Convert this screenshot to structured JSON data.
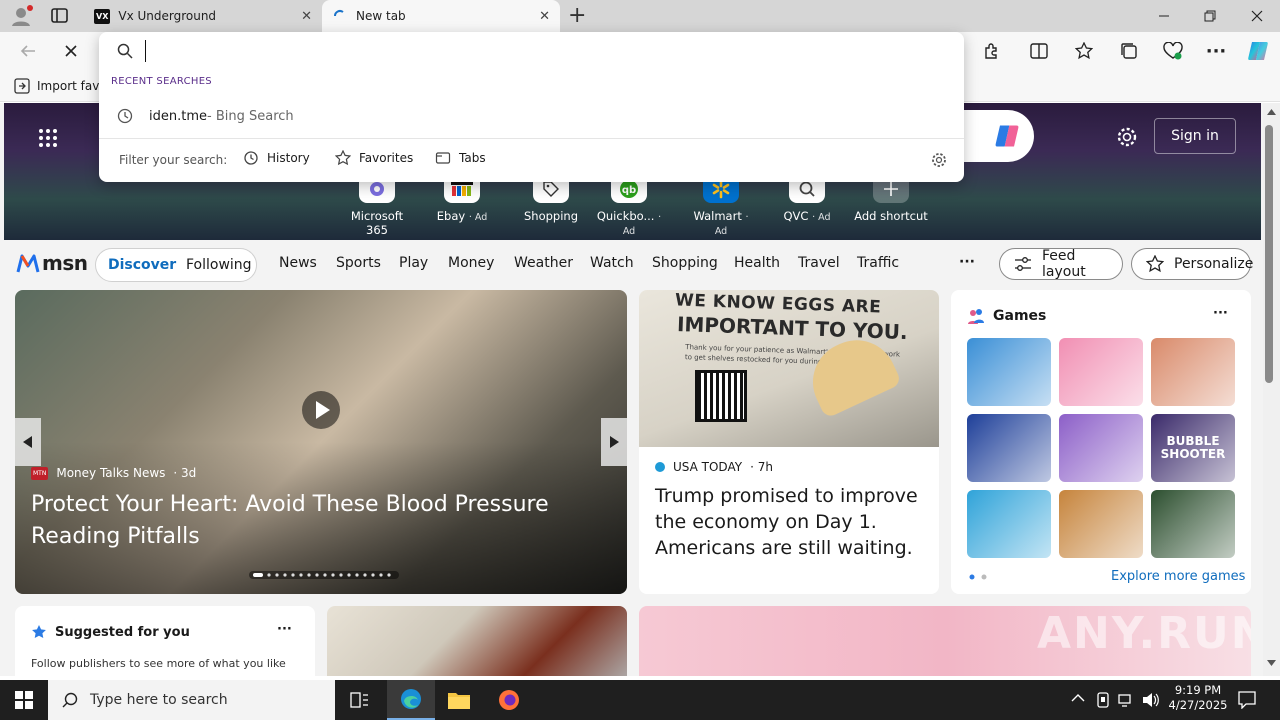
{
  "browser": {
    "tabs": [
      {
        "title": "Vx Underground",
        "favicon": "VX",
        "close": "✕"
      },
      {
        "title": "New tab",
        "close": "✕"
      }
    ],
    "new_tab": "+",
    "favbar_text": "Import favo"
  },
  "omnibox": {
    "value": "",
    "recent_header": "RECENT SEARCHES",
    "recent": [
      {
        "text": "iden.tme",
        "suffix": " - Bing Search"
      }
    ],
    "filter_label": "Filter your search:",
    "filters": [
      "History",
      "Favorites",
      "Tabs"
    ]
  },
  "hero": {
    "sign_in": "Sign in",
    "tiles": [
      {
        "label": "Microsoft 365",
        "ad": ""
      },
      {
        "label": "Ebay",
        "ad": "· Ad"
      },
      {
        "label": "Shopping",
        "ad": ""
      },
      {
        "label": "Quickbo...",
        "ad": "· Ad"
      },
      {
        "label": "Walmart",
        "ad": "· Ad"
      },
      {
        "label": "QVC",
        "ad": "· Ad"
      },
      {
        "label": "Add shortcut",
        "ad": ""
      }
    ]
  },
  "msn": {
    "brand": "msn",
    "discover": "Discover",
    "following": "Following",
    "nav": [
      "News",
      "Sports",
      "Play",
      "Money",
      "Weather",
      "Watch",
      "Shopping",
      "Health",
      "Travel",
      "Traffic"
    ],
    "more": "···",
    "feed_layout": "Feed layout",
    "personalize": "Personalize"
  },
  "hero_story": {
    "source": "Money Talks News",
    "age": "· 3d",
    "source_badge": "MTN",
    "title": "Protect Your Heart: Avoid These Blood Pressure Reading Pitfalls"
  },
  "egg_story": {
    "sign_line1": "WE KNOW EGGS ARE",
    "sign_line2": "IMPORTANT TO YOU.",
    "sign_small": "Thank you for your patience as Walmart's egg suppliers work to get shelves restocked for you during this time.",
    "source": "USA TODAY",
    "age": "· 7h",
    "title": "Trump promised to improve the economy on Day 1. Americans are still waiting."
  },
  "games": {
    "title": "Games",
    "more": "···",
    "explore": "Explore more games",
    "bubble_label": "BUBBLE SHOOTER",
    "colors": [
      "#3a8fd6",
      "#f18fb3",
      "#d98a6a",
      "#1e3f99",
      "#8c5fc8",
      "#3a2a6a",
      "#2fa3d9",
      "#c6843c",
      "#2c4f2f"
    ]
  },
  "suggested": {
    "title": "Suggested for you",
    "more": "···",
    "text": "Follow publishers to see more of what you like"
  },
  "taskbar": {
    "search_placeholder": "Type here to search",
    "time": "9:19 PM",
    "date": "4/27/2025"
  },
  "watermark": "ANY.RUN"
}
